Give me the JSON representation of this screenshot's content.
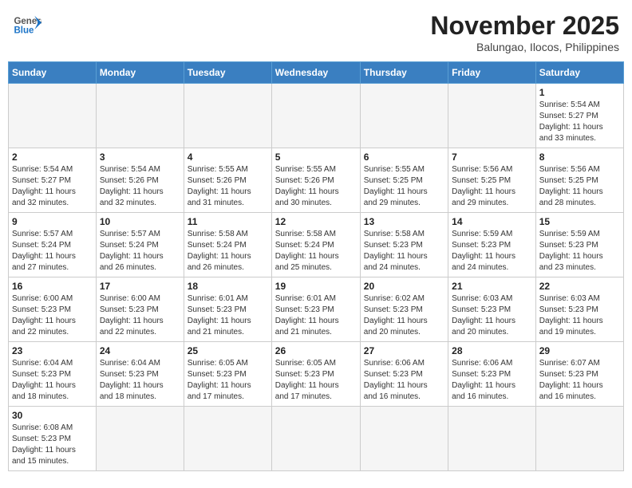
{
  "header": {
    "logo_general": "General",
    "logo_blue": "Blue",
    "month_title": "November 2025",
    "location": "Balungao, Ilocos, Philippines"
  },
  "days_of_week": [
    "Sunday",
    "Monday",
    "Tuesday",
    "Wednesday",
    "Thursday",
    "Friday",
    "Saturday"
  ],
  "weeks": [
    [
      {
        "day": "",
        "info": ""
      },
      {
        "day": "",
        "info": ""
      },
      {
        "day": "",
        "info": ""
      },
      {
        "day": "",
        "info": ""
      },
      {
        "day": "",
        "info": ""
      },
      {
        "day": "",
        "info": ""
      },
      {
        "day": "1",
        "info": "Sunrise: 5:54 AM\nSunset: 5:27 PM\nDaylight: 11 hours\nand 33 minutes."
      }
    ],
    [
      {
        "day": "2",
        "info": "Sunrise: 5:54 AM\nSunset: 5:27 PM\nDaylight: 11 hours\nand 32 minutes."
      },
      {
        "day": "3",
        "info": "Sunrise: 5:54 AM\nSunset: 5:26 PM\nDaylight: 11 hours\nand 32 minutes."
      },
      {
        "day": "4",
        "info": "Sunrise: 5:55 AM\nSunset: 5:26 PM\nDaylight: 11 hours\nand 31 minutes."
      },
      {
        "day": "5",
        "info": "Sunrise: 5:55 AM\nSunset: 5:26 PM\nDaylight: 11 hours\nand 30 minutes."
      },
      {
        "day": "6",
        "info": "Sunrise: 5:55 AM\nSunset: 5:25 PM\nDaylight: 11 hours\nand 29 minutes."
      },
      {
        "day": "7",
        "info": "Sunrise: 5:56 AM\nSunset: 5:25 PM\nDaylight: 11 hours\nand 29 minutes."
      },
      {
        "day": "8",
        "info": "Sunrise: 5:56 AM\nSunset: 5:25 PM\nDaylight: 11 hours\nand 28 minutes."
      }
    ],
    [
      {
        "day": "9",
        "info": "Sunrise: 5:57 AM\nSunset: 5:24 PM\nDaylight: 11 hours\nand 27 minutes."
      },
      {
        "day": "10",
        "info": "Sunrise: 5:57 AM\nSunset: 5:24 PM\nDaylight: 11 hours\nand 26 minutes."
      },
      {
        "day": "11",
        "info": "Sunrise: 5:58 AM\nSunset: 5:24 PM\nDaylight: 11 hours\nand 26 minutes."
      },
      {
        "day": "12",
        "info": "Sunrise: 5:58 AM\nSunset: 5:24 PM\nDaylight: 11 hours\nand 25 minutes."
      },
      {
        "day": "13",
        "info": "Sunrise: 5:58 AM\nSunset: 5:23 PM\nDaylight: 11 hours\nand 24 minutes."
      },
      {
        "day": "14",
        "info": "Sunrise: 5:59 AM\nSunset: 5:23 PM\nDaylight: 11 hours\nand 24 minutes."
      },
      {
        "day": "15",
        "info": "Sunrise: 5:59 AM\nSunset: 5:23 PM\nDaylight: 11 hours\nand 23 minutes."
      }
    ],
    [
      {
        "day": "16",
        "info": "Sunrise: 6:00 AM\nSunset: 5:23 PM\nDaylight: 11 hours\nand 22 minutes."
      },
      {
        "day": "17",
        "info": "Sunrise: 6:00 AM\nSunset: 5:23 PM\nDaylight: 11 hours\nand 22 minutes."
      },
      {
        "day": "18",
        "info": "Sunrise: 6:01 AM\nSunset: 5:23 PM\nDaylight: 11 hours\nand 21 minutes."
      },
      {
        "day": "19",
        "info": "Sunrise: 6:01 AM\nSunset: 5:23 PM\nDaylight: 11 hours\nand 21 minutes."
      },
      {
        "day": "20",
        "info": "Sunrise: 6:02 AM\nSunset: 5:23 PM\nDaylight: 11 hours\nand 20 minutes."
      },
      {
        "day": "21",
        "info": "Sunrise: 6:03 AM\nSunset: 5:23 PM\nDaylight: 11 hours\nand 20 minutes."
      },
      {
        "day": "22",
        "info": "Sunrise: 6:03 AM\nSunset: 5:23 PM\nDaylight: 11 hours\nand 19 minutes."
      }
    ],
    [
      {
        "day": "23",
        "info": "Sunrise: 6:04 AM\nSunset: 5:23 PM\nDaylight: 11 hours\nand 18 minutes."
      },
      {
        "day": "24",
        "info": "Sunrise: 6:04 AM\nSunset: 5:23 PM\nDaylight: 11 hours\nand 18 minutes."
      },
      {
        "day": "25",
        "info": "Sunrise: 6:05 AM\nSunset: 5:23 PM\nDaylight: 11 hours\nand 17 minutes."
      },
      {
        "day": "26",
        "info": "Sunrise: 6:05 AM\nSunset: 5:23 PM\nDaylight: 11 hours\nand 17 minutes."
      },
      {
        "day": "27",
        "info": "Sunrise: 6:06 AM\nSunset: 5:23 PM\nDaylight: 11 hours\nand 16 minutes."
      },
      {
        "day": "28",
        "info": "Sunrise: 6:06 AM\nSunset: 5:23 PM\nDaylight: 11 hours\nand 16 minutes."
      },
      {
        "day": "29",
        "info": "Sunrise: 6:07 AM\nSunset: 5:23 PM\nDaylight: 11 hours\nand 16 minutes."
      }
    ],
    [
      {
        "day": "30",
        "info": "Sunrise: 6:08 AM\nSunset: 5:23 PM\nDaylight: 11 hours\nand 15 minutes."
      },
      {
        "day": "",
        "info": ""
      },
      {
        "day": "",
        "info": ""
      },
      {
        "day": "",
        "info": ""
      },
      {
        "day": "",
        "info": ""
      },
      {
        "day": "",
        "info": ""
      },
      {
        "day": "",
        "info": ""
      }
    ]
  ]
}
